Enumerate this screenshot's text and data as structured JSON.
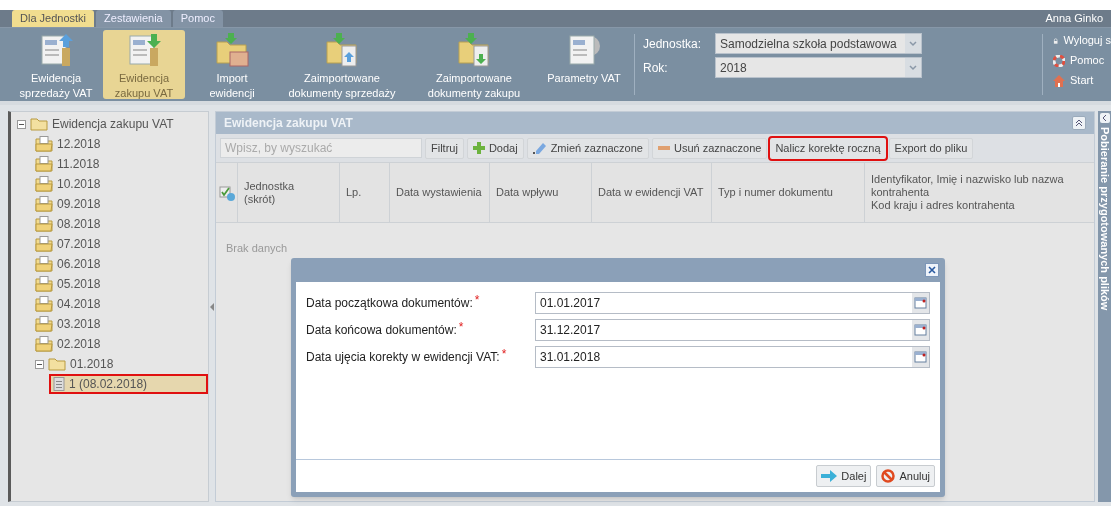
{
  "menu_tabs": [
    {
      "label": "Dla Jednostki",
      "selected": true
    },
    {
      "label": "Zestawienia",
      "selected": false
    },
    {
      "label": "Pomoc",
      "selected": false
    }
  ],
  "user_name": "Anna Ginko",
  "ribbon": [
    {
      "label": "Ewidencja sprzedaży VAT",
      "kind": "upload",
      "selected": false
    },
    {
      "label": "Ewidencja zakupu VAT",
      "kind": "download",
      "selected": true
    },
    {
      "label": "Import ewidencji",
      "kind": "import",
      "selected": false
    },
    {
      "label": "Zaimportowane dokumenty sprzedaży",
      "kind": "imported-up",
      "selected": false
    },
    {
      "label": "Zaimportowane dokumenty zakupu",
      "kind": "imported-down",
      "selected": false
    },
    {
      "label": "Parametry VAT",
      "kind": "gear",
      "selected": false
    }
  ],
  "context": [
    {
      "label": "Jednostka:",
      "value": "Samodzielna szkoła podstawowa"
    },
    {
      "label": "Rok:",
      "value": "2018"
    }
  ],
  "quick_links": [
    {
      "label": "Wyloguj s",
      "kind": "lock"
    },
    {
      "label": "Pomoc",
      "kind": "lifebuoy"
    },
    {
      "label": "Start",
      "kind": "home"
    }
  ],
  "tree": {
    "label": "Ewidencja zakupu VAT",
    "expanded": true,
    "children": [
      {
        "label": "12.2018"
      },
      {
        "label": "11.2018"
      },
      {
        "label": "10.2018"
      },
      {
        "label": "09.2018"
      },
      {
        "label": "08.2018"
      },
      {
        "label": "07.2018"
      },
      {
        "label": "06.2018"
      },
      {
        "label": "05.2018"
      },
      {
        "label": "04.2018"
      },
      {
        "label": "03.2018"
      },
      {
        "label": "02.2018"
      },
      {
        "label": "01.2018",
        "expanded": true,
        "children": [
          {
            "label": "1 (08.02.2018)",
            "kind": "document",
            "selected": true,
            "highlighted": true
          }
        ]
      }
    ]
  },
  "panel": {
    "title": "Ewidencja zakupu VAT",
    "search": {
      "placeholder": "Wpisz, by wyszukać"
    },
    "toolbar": [
      {
        "label": "Filtruj",
        "kind": "text",
        "highlighted": false
      },
      {
        "label": "Dodaj",
        "kind": "add",
        "highlighted": false
      },
      {
        "label": "Zmień zaznaczone",
        "kind": "edit",
        "highlighted": false
      },
      {
        "label": "Usuń zaznaczone",
        "kind": "remove",
        "highlighted": false
      },
      {
        "label": "Nalicz korektę roczną",
        "kind": "text",
        "highlighted": true
      },
      {
        "label": "Export do pliku",
        "kind": "text",
        "highlighted": false
      }
    ],
    "columns": [
      [
        "Jednostka",
        "(skrót)"
      ],
      [
        "Lp."
      ],
      [
        "Data wystawienia"
      ],
      [
        "Data wpływu"
      ],
      [
        "Data w ewidencji VAT"
      ],
      [
        "Typ i numer dokumentu"
      ],
      [
        "Identyfikator, Imię i nazwisko lub nazwa kontrahenta",
        "Kod kraju i adres kontrahenta"
      ]
    ],
    "empty_text": "Brak danych"
  },
  "side_strip": {
    "label": "Pobieranie przygotowanych plików"
  },
  "dialog": {
    "fields": [
      {
        "label": "Data początkowa dokumentów:",
        "required_mark": "*",
        "value": "01.01.2017"
      },
      {
        "label": "Data końcowa dokumentów:",
        "required_mark": "*",
        "value": "31.12.2017"
      },
      {
        "label": "Data ujęcia korekty w ewidencji VAT:",
        "required_mark": "*",
        "value": "31.01.2018"
      }
    ],
    "buttons": [
      {
        "label": "Dalej",
        "kind": "next"
      },
      {
        "label": "Anuluj",
        "kind": "cancel"
      }
    ]
  }
}
